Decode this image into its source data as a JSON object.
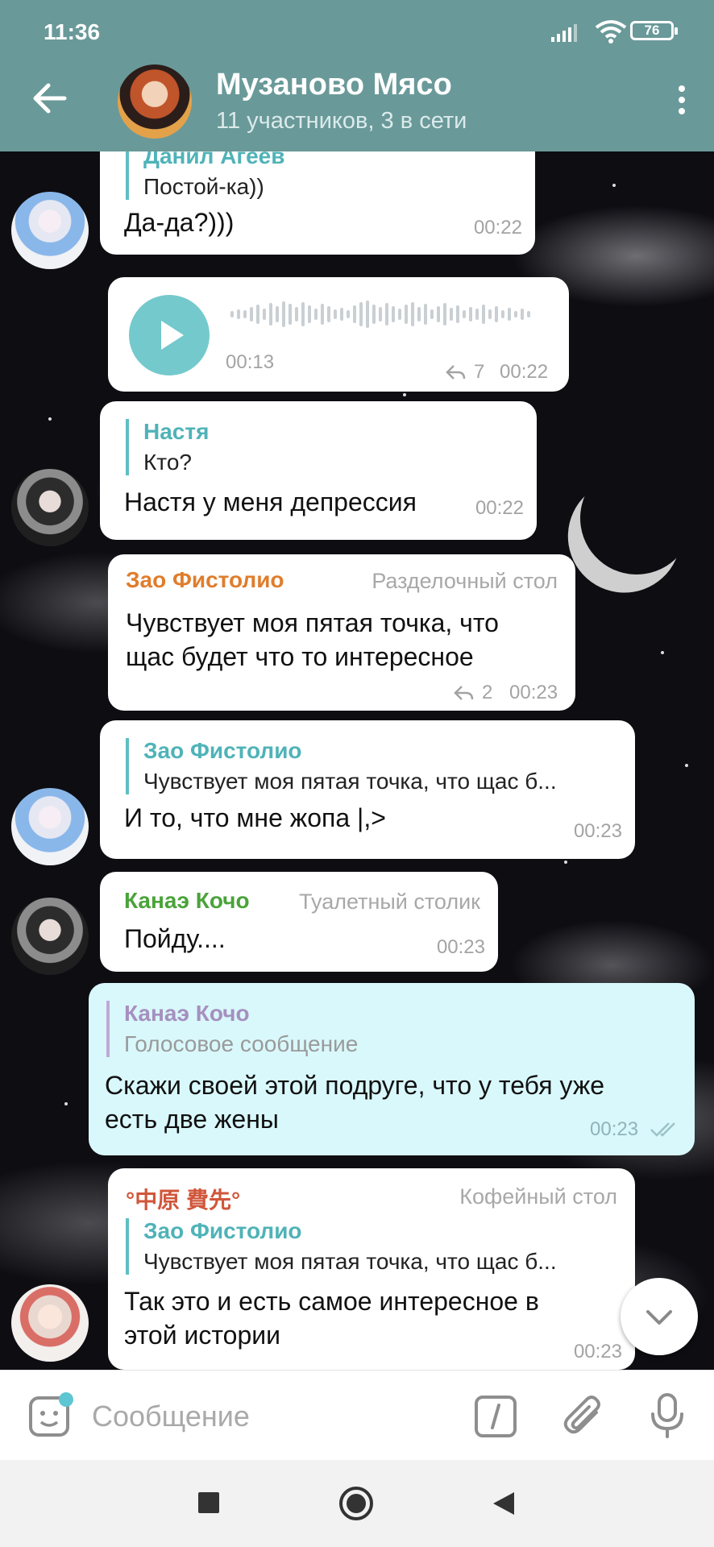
{
  "status_bar": {
    "time": "11:36",
    "battery": "76"
  },
  "header": {
    "title": "Музаново Мясо",
    "subtitle": "11 участников, 3 в сети"
  },
  "messages": [
    {
      "reply_name": "Данил Агеев",
      "reply_text": "Постой-ка))",
      "text": "Да-да?)))",
      "time": "00:22"
    },
    {
      "type": "voice",
      "duration": "00:13",
      "forwards": "7",
      "time": "00:22"
    },
    {
      "reply_name": "Настя",
      "reply_text": "Кто?",
      "text": "Настя у меня депрессия",
      "time": "00:22"
    },
    {
      "sender": "Зао Фистолио",
      "tag": "Разделочный стол",
      "text_lines": [
        "Чувствует моя пятая точка, что",
        "щас будет что то интересное"
      ],
      "replies": "2",
      "time": "00:23",
      "sender_color": "#e07d2c"
    },
    {
      "reply_name": "Зао Фистолио",
      "reply_text": "Чувствует моя пятая точка, что щас б...",
      "text": "И то, что мне жопа |,>",
      "time": "00:23"
    },
    {
      "sender": "Канаэ Кочо",
      "tag": "Туалетный столик",
      "text": "Пойду....",
      "time": "00:23",
      "sender_color": "#4aa33a"
    },
    {
      "reply_name": "Канаэ Кочо",
      "reply_text": "Голосовое сообщение",
      "text_lines": [
        "Скажи своей этой подруге, что у тебя уже",
        "есть две жены"
      ],
      "time": "00:23",
      "outgoing": true
    },
    {
      "sender": "°中原 費先°",
      "tag": "Кофейный стол",
      "reply_name": "Зао Фистолио",
      "reply_text": "Чувствует моя пятая точка, что щас б...",
      "text_lines": [
        "Так это и есть самое интересное в",
        "этой истории"
      ],
      "time": "00:23",
      "sender_color": "#d0563a"
    }
  ],
  "input": {
    "placeholder": "Сообщение"
  },
  "icons": [
    "back-arrow-icon",
    "more-vert-icon",
    "play-icon",
    "reply-arrow-icon",
    "read-checks-icon",
    "scroll-down-chevron-icon",
    "sticker-icon",
    "command-slash-icon",
    "attach-clip-icon",
    "mic-icon",
    "nav-square-icon",
    "nav-circle-icon",
    "nav-back-triangle-icon"
  ],
  "colors": {
    "header": "#6a9999",
    "accent": "#74c9cc",
    "outgoing_bubble": "#d9f8fb"
  }
}
